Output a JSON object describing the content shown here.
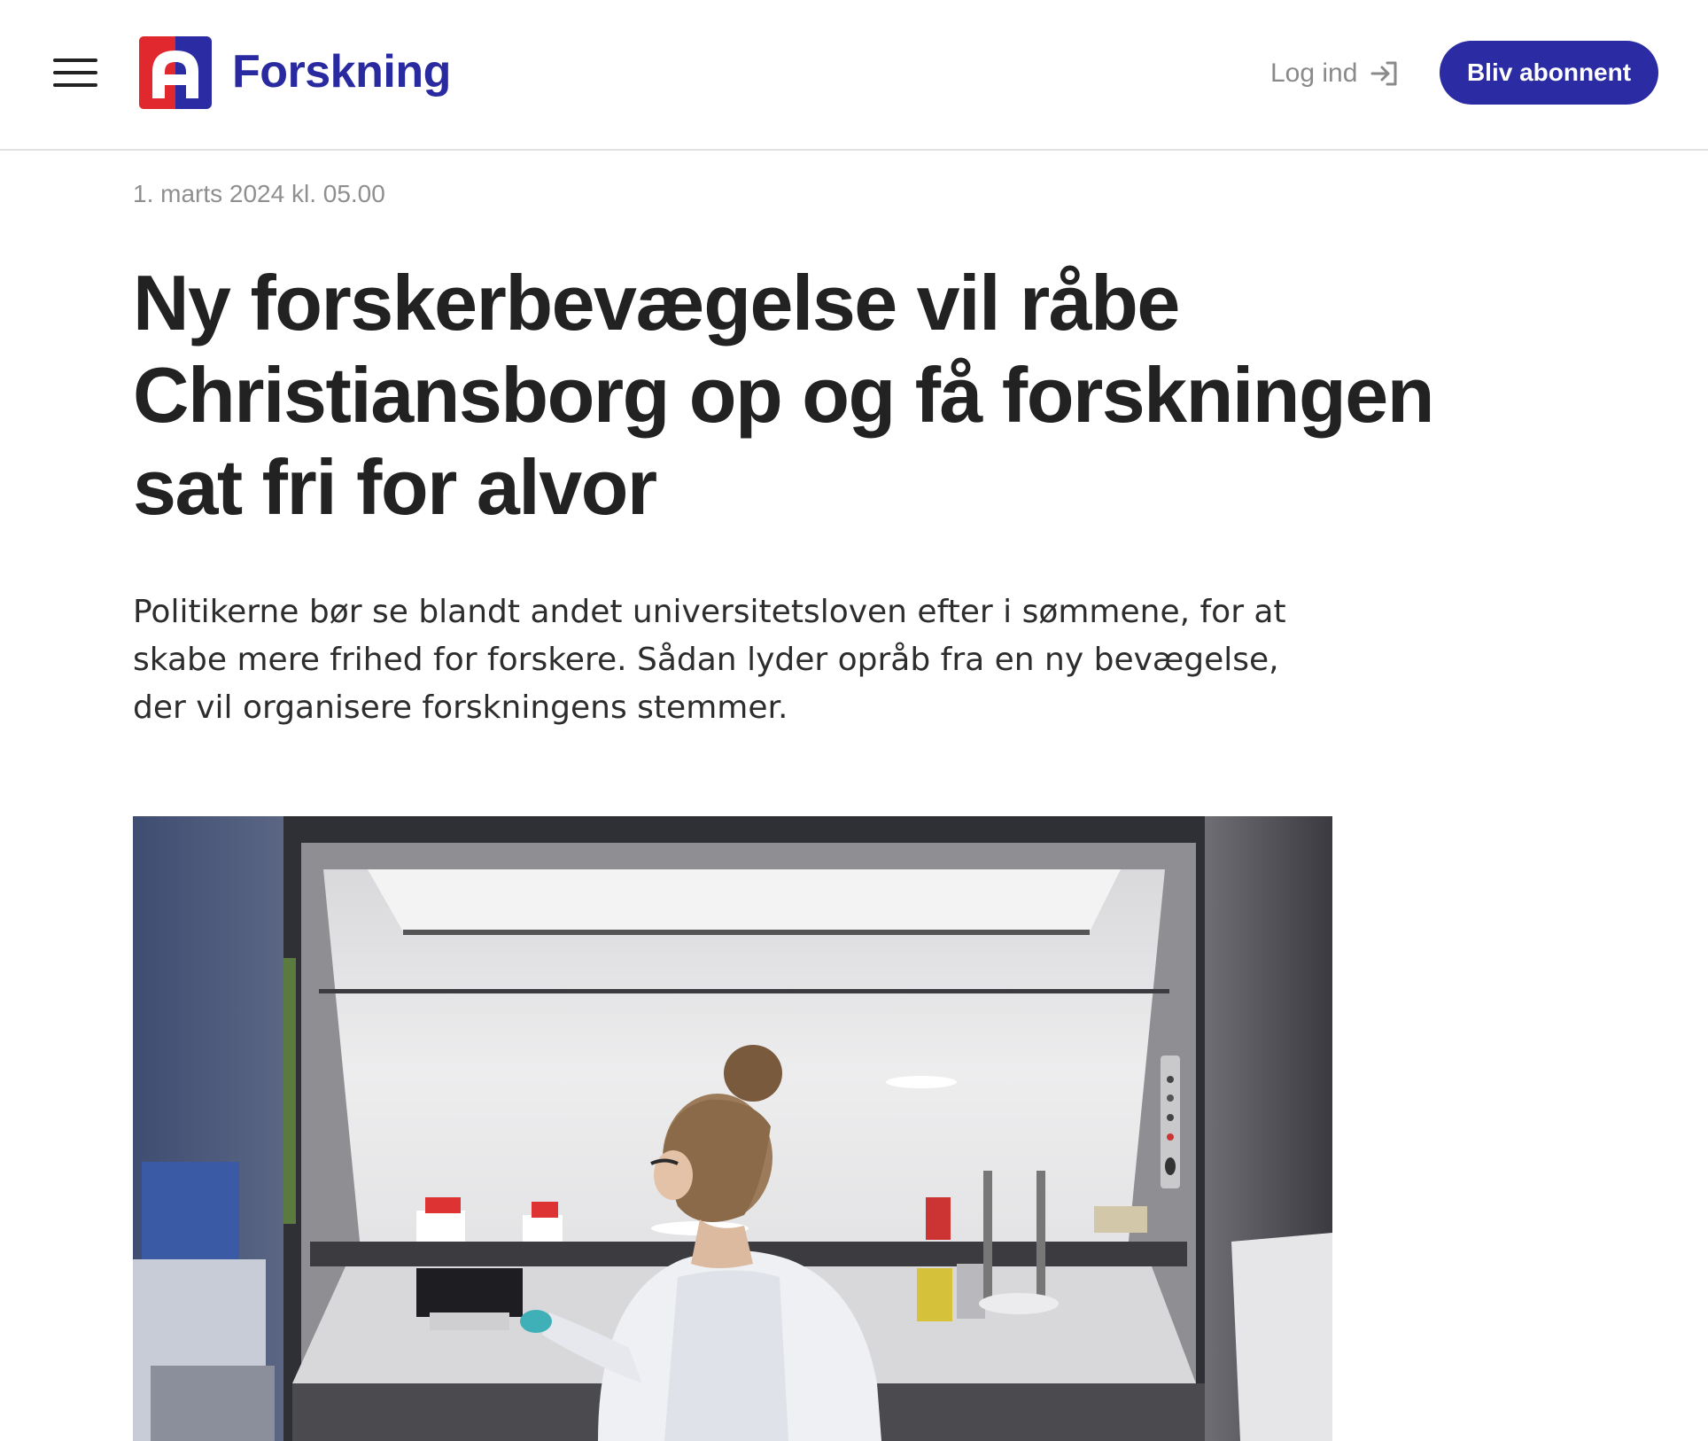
{
  "header": {
    "menu_icon": "hamburger-menu-icon",
    "logo_icon": "a-logo-icon",
    "brand": "Forskning",
    "login_label": "Log ind",
    "login_icon": "sign-in-icon",
    "subscribe_label": "Bliv abonnent",
    "colors": {
      "brand_blue": "#2b2ba3",
      "logo_red": "#e0282e"
    }
  },
  "article": {
    "dateline": "1. marts 2024 kl. 05.00",
    "headline": "Ny forskerbevægelse vil råbe Christiansborg op og få forskningen sat fri for alvor",
    "lede": "Politikerne bør se blandt andet universitetsloven efter i sømmene, for at skabe mere frihed for forskere. Sådan lyder opråb fra en ny bevægelse, der vil organisere forskningens stemmer."
  }
}
